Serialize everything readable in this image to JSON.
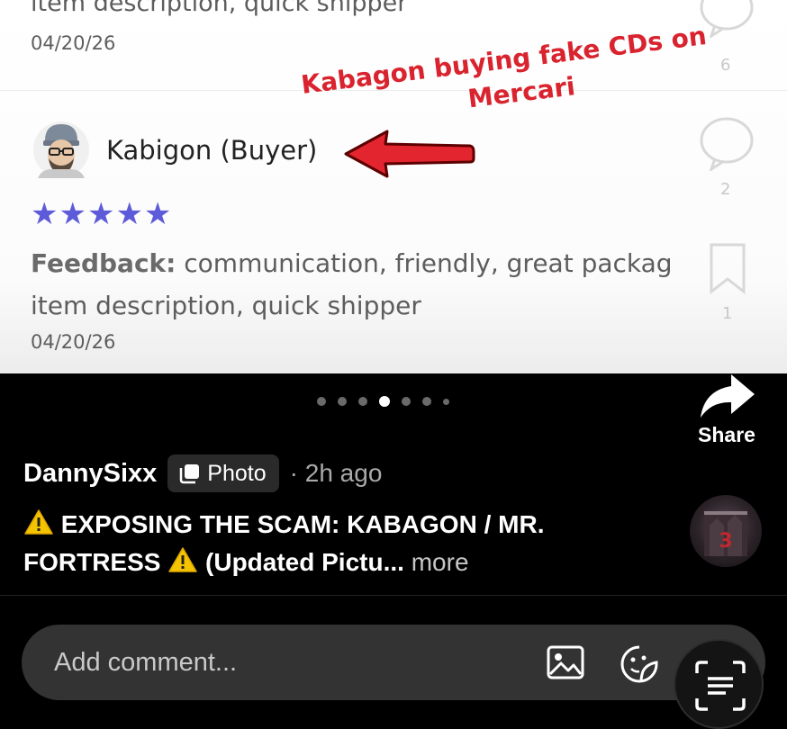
{
  "review_previous": {
    "description": "item description, quick shipper",
    "date": "04/20/26"
  },
  "review": {
    "name": "Kabigon (Buyer)",
    "stars": "★★★★★",
    "feedback_label": "Feedback:",
    "feedback_text": "communication, friendly, great packag",
    "description": "item description, quick shipper",
    "date": "04/20/26"
  },
  "annotation": {
    "line1": "Kabagon buying fake CDs on",
    "line2": "Mercari",
    "color": "#d9232e"
  },
  "overlay_counts": {
    "comments": "6",
    "replies": "2",
    "saves": "1"
  },
  "carousel": {
    "total": 7,
    "active_index": 3
  },
  "share": {
    "label": "Share"
  },
  "post": {
    "author": "DannySixx",
    "type_label": "Photo",
    "time": "· 2h ago",
    "caption_part1": "EXPOSING THE SCAM: KABAGON / MR. FORTRESS",
    "caption_part2": "(Updated Pictu...",
    "more_label": "more"
  },
  "comment": {
    "placeholder": "Add comment..."
  },
  "icons": {
    "share": "share-arrow-icon",
    "photo": "photo-icon",
    "image": "image-icon",
    "sticker": "sticker-icon",
    "scan": "text-scan-icon",
    "warning": "warning-icon"
  },
  "colors": {
    "star": "#5d5bd9",
    "background": "#000000",
    "input": "#333333"
  }
}
